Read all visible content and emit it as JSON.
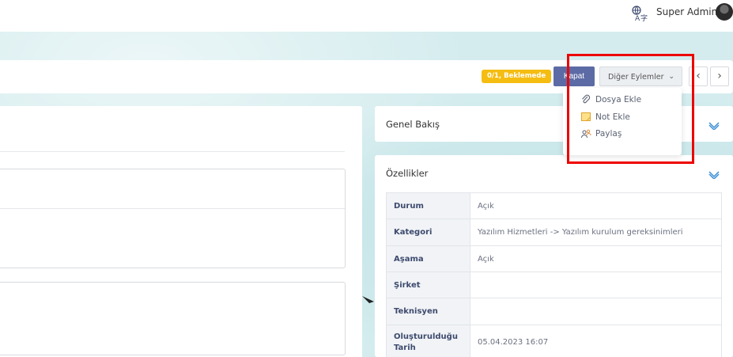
{
  "topbar": {
    "user_name": "Super Admin",
    "language_icon": "translate-icon",
    "avatar_icon": "user-avatar"
  },
  "actions": {
    "status_badge": "0/1, Beklemede",
    "close_label": "Kapat",
    "more_label": "Diğer Eylemler",
    "prev_symbol": "‹",
    "next_symbol": "›"
  },
  "dropdown": {
    "items": [
      {
        "label": "Dosya Ekle",
        "icon": "paperclip-icon"
      },
      {
        "label": "Not Ekle",
        "icon": "note-icon"
      },
      {
        "label": "Paylaş",
        "icon": "share-users-icon"
      }
    ]
  },
  "overview": {
    "title": "Genel Bakış"
  },
  "properties": {
    "title": "Özellikler",
    "rows": [
      {
        "key": "Durum",
        "value": "Açık"
      },
      {
        "key": "Kategori",
        "value": "Yazılım Hizmetleri -> Yazılım kurulum gereksinimleri"
      },
      {
        "key": "Aşama",
        "value": "Açık"
      },
      {
        "key": "Şirket",
        "value": ""
      },
      {
        "key": "Teknisyen",
        "value": ""
      },
      {
        "key": "Oluşturulduğu Tarih",
        "value": "05.04.2023 16:07"
      }
    ]
  },
  "colors": {
    "accent": "#5c6ba5",
    "badge": "#f5bd12",
    "highlight": "#ee0000",
    "chevron": "#3b8fd6"
  }
}
